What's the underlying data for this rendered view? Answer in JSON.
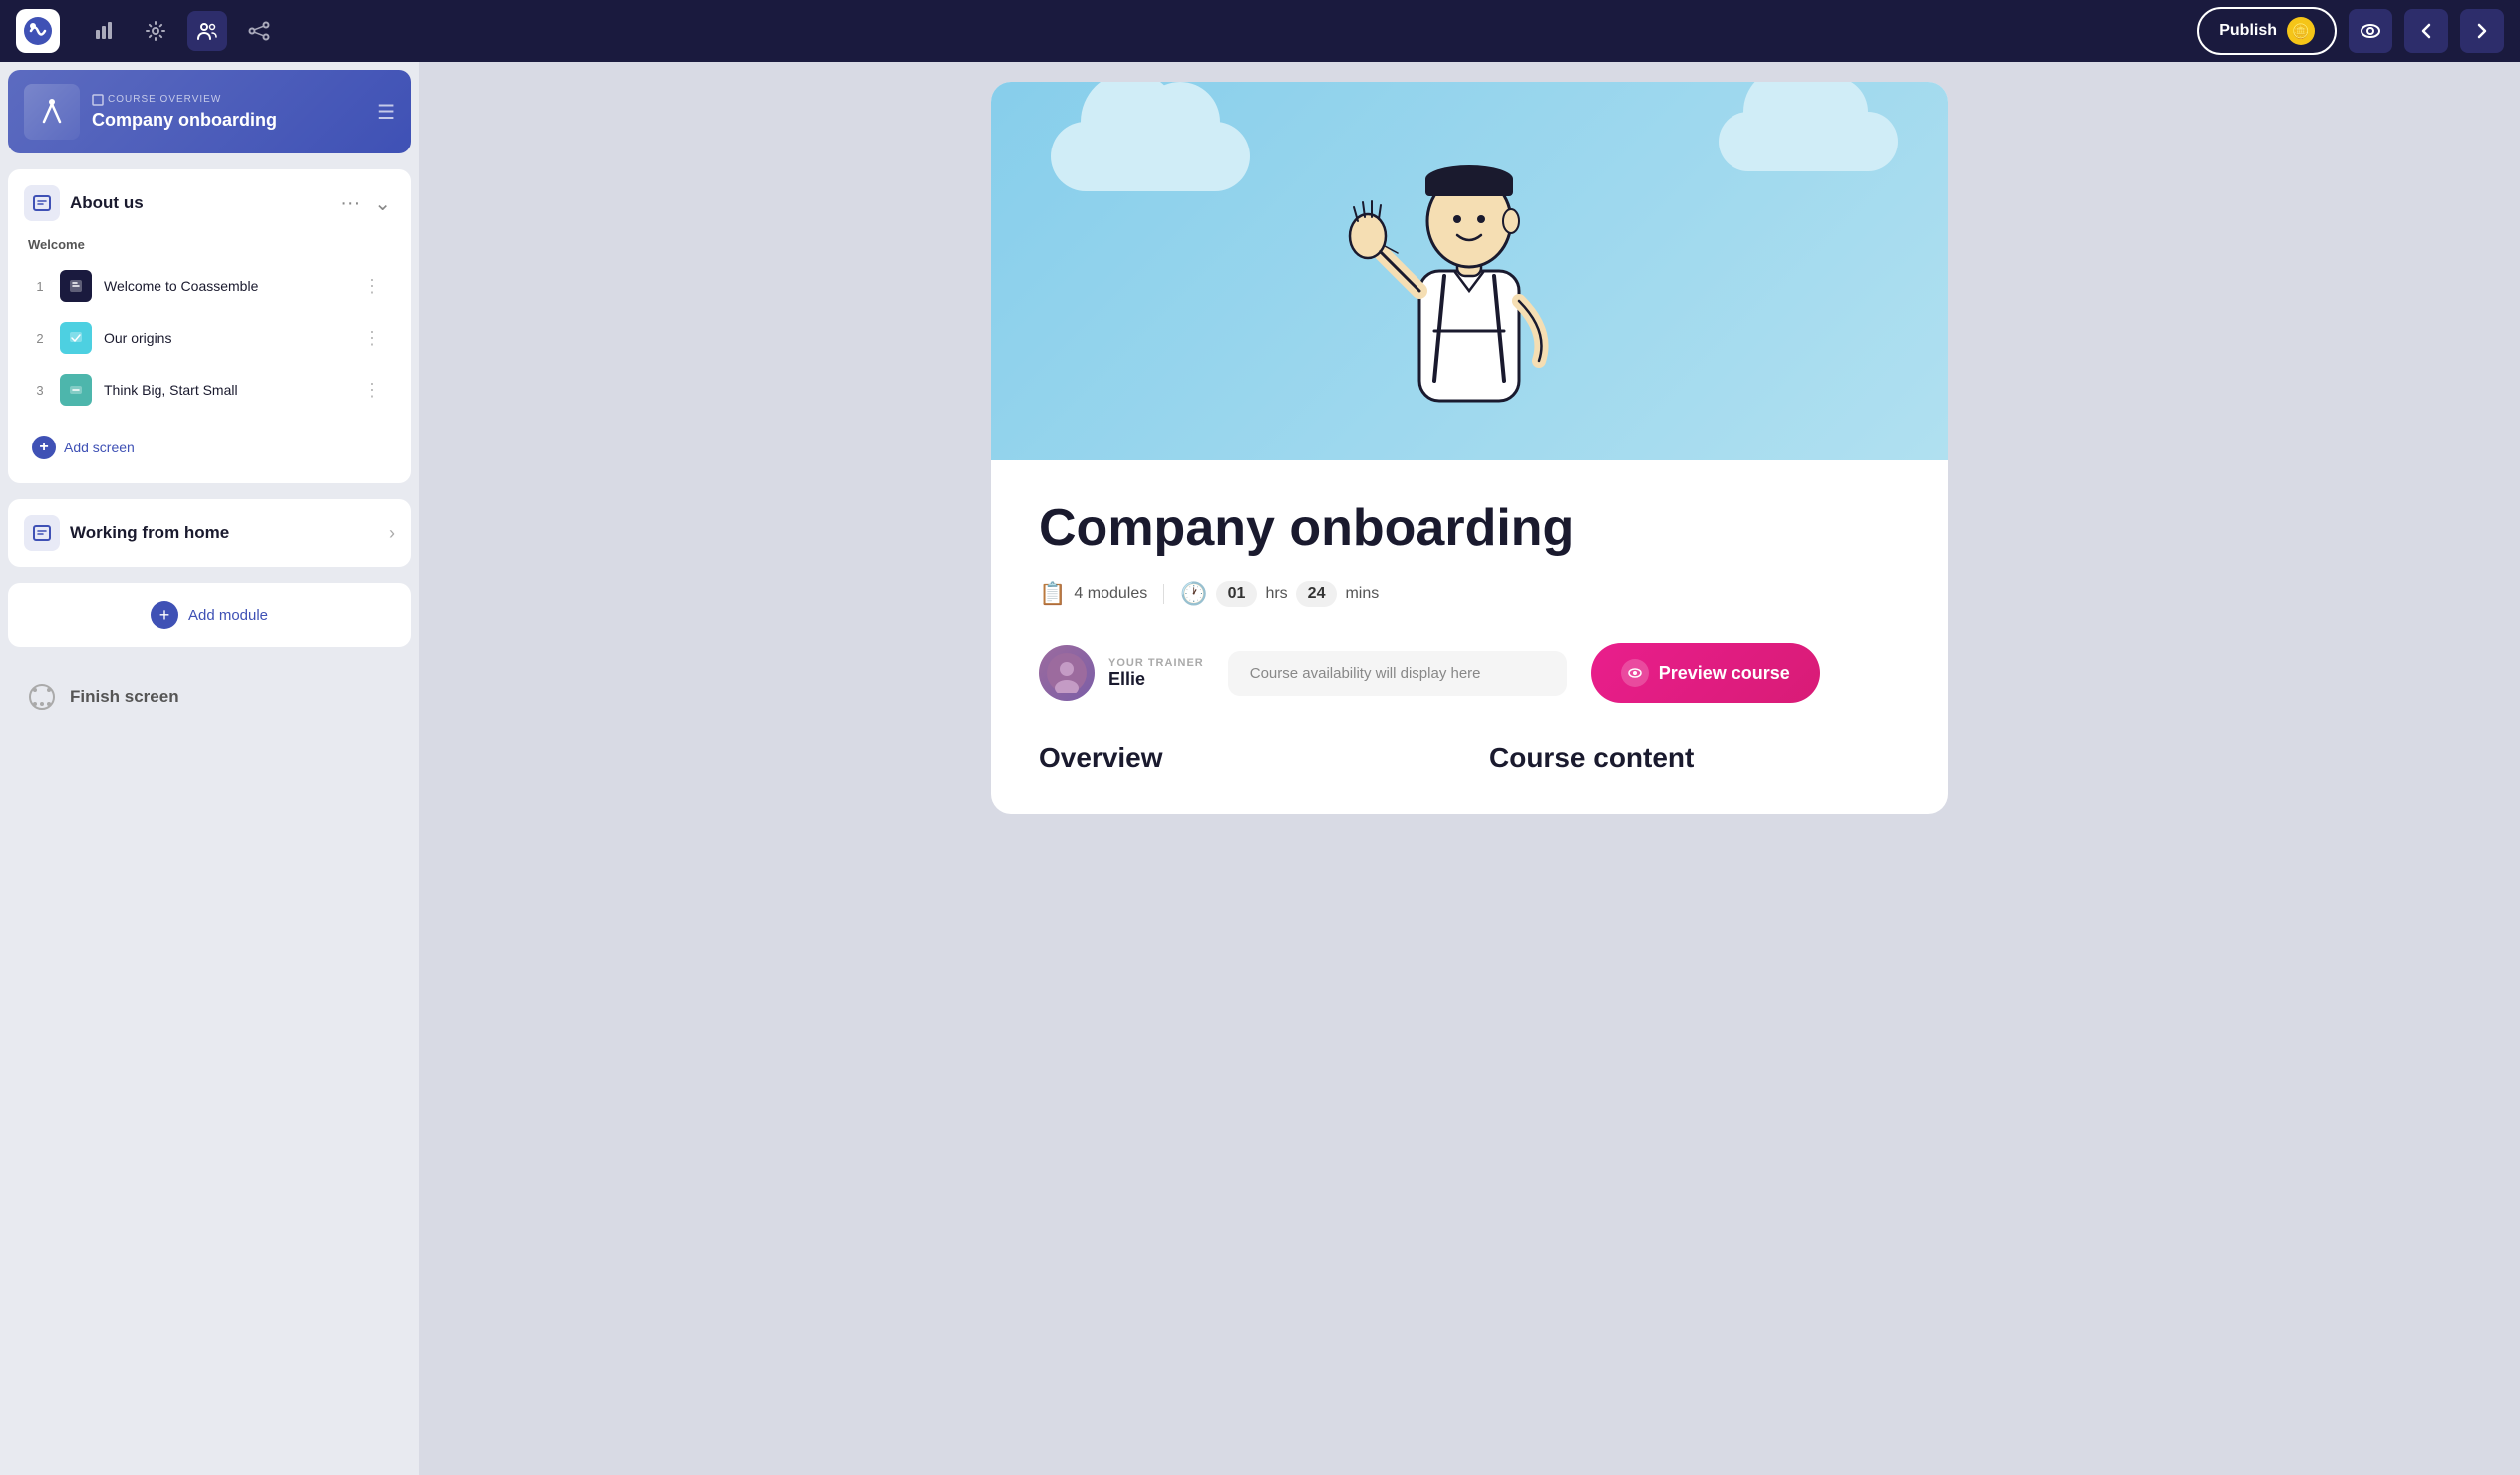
{
  "app": {
    "name": "Coassemble"
  },
  "topnav": {
    "publish_label": "Publish",
    "back_label": "←",
    "forward_label": "→"
  },
  "sidebar": {
    "course_overview_label": "COURSE OVERVIEW",
    "course_title": "Company onboarding",
    "modules": [
      {
        "id": "about-us",
        "title": "About us",
        "expanded": true,
        "sections": [
          {
            "label": "Welcome",
            "screens": [
              {
                "num": "1",
                "name": "Welcome to Coassemble",
                "icon_type": "dark"
              },
              {
                "num": "2",
                "name": "Our origins",
                "icon_type": "blue"
              },
              {
                "num": "3",
                "name": "Think Big, Start Small",
                "icon_type": "teal"
              }
            ]
          }
        ],
        "add_screen_label": "Add screen"
      },
      {
        "id": "working-from-home",
        "title": "Working from home",
        "expanded": false
      }
    ],
    "add_module_label": "Add module",
    "finish_screen_label": "Finish screen"
  },
  "main": {
    "course_title": "Company onboarding",
    "modules_count": "4 modules",
    "hours": "01",
    "mins": "24",
    "time_label_hrs": "hrs",
    "time_label_mins": "mins",
    "trainer_label": "YOUR TRAINER",
    "trainer_name": "Ellie",
    "availability_placeholder": "Course availability will display here",
    "preview_label": "Preview course",
    "overview_title": "Overview",
    "course_content_title": "Course content"
  }
}
